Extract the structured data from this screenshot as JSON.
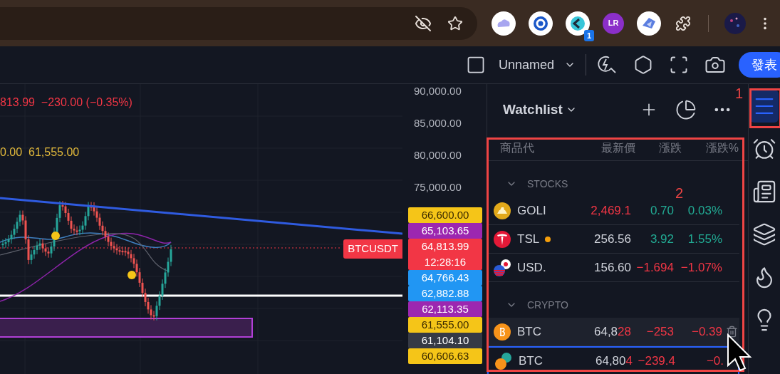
{
  "browser": {
    "extensions": [
      {
        "kind": "cloud"
      },
      {
        "kind": "target"
      },
      {
        "kind": "arrow",
        "badge": "1"
      },
      {
        "kind": "letters",
        "label": "LR"
      },
      {
        "kind": "bird"
      }
    ]
  },
  "toolbar": {
    "layout_name": "Unnamed",
    "publish_button": "發表"
  },
  "chart": {
    "legend": [
      {
        "text": "813.99  −230.00 (−0.35%)",
        "color": "#f23645"
      },
      {
        "text": "0.00  61,555.00",
        "color": "#e2b93b"
      }
    ],
    "symbol_tag": "BTCUSDT"
  },
  "price_axis": {
    "ticks": [
      "90,000.00",
      "85,000.00",
      "80,000.00",
      "75,000.00"
    ],
    "tags": [
      {
        "value": "66,600.00",
        "color": "#f5c518"
      },
      {
        "value": "65,103.65",
        "color": "#9c27b0"
      },
      {
        "value": "64,813.99",
        "time": "12:28:16",
        "color": "#f23645"
      },
      {
        "value": "64,766.43",
        "color": "#2196f3"
      },
      {
        "value": "62,882.88",
        "color": "#2196f3"
      },
      {
        "value": "62,113.35",
        "color": "#9c27b0"
      },
      {
        "value": "61,555.00",
        "color": "#f5c518"
      },
      {
        "value": "61,104.10",
        "color": "#363a45"
      },
      {
        "value": "60,606.63",
        "color": "#f5c518"
      }
    ]
  },
  "watchlist": {
    "title": "Watchlist",
    "columns": [
      "商品代",
      "最新價",
      "漲跌",
      "漲跌%"
    ],
    "groups": [
      {
        "name": "STOCKS",
        "expanded": true,
        "rows": [
          {
            "kind": "gold",
            "symbol": "GOLI",
            "status_dot": false,
            "last_parts": [
              {
                "text": "2,469.1",
                "flash": true
              }
            ],
            "change": "0.70",
            "change_pct": "0.03%",
            "rising": true,
            "hovered": false,
            "selected": false
          },
          {
            "kind": "t-badge",
            "symbol": "TSL",
            "status_dot": true,
            "last_parts": [
              {
                "text": "256.56",
                "flash": false
              }
            ],
            "change": "3.92",
            "change_pct": "1.55%",
            "rising": true,
            "hovered": false,
            "selected": false
          },
          {
            "kind": "flag-pair",
            "symbol": "USD.",
            "status_dot": false,
            "last_parts": [
              {
                "text": "156.60",
                "flash": false
              }
            ],
            "change": "−1.694",
            "change_pct": "−1.07%",
            "rising": false,
            "hovered": false,
            "selected": false
          }
        ]
      },
      {
        "name": "CRYPTO",
        "expanded": true,
        "rows": [
          {
            "kind": "bitcoin",
            "symbol": "BTC",
            "status_dot": false,
            "last_parts": [
              {
                "text": "64,8",
                "flash": false
              },
              {
                "text": "28",
                "flash": true
              }
            ],
            "change": "−253",
            "change_pct": "−0.39",
            "rising": false,
            "hovered": true,
            "selected": false
          },
          {
            "kind": "coin-pair",
            "symbol": "BTC",
            "status_dot": false,
            "last_parts": [
              {
                "text": "64,80",
                "flash": false
              },
              {
                "text": "4",
                "flash": true
              }
            ],
            "change": "−239.4",
            "change_pct": "−0.",
            "rising": false,
            "hovered": false,
            "selected": true
          }
        ]
      }
    ]
  },
  "sidebar": [
    {
      "kind": "list",
      "selected": true
    },
    {
      "kind": "alarm",
      "selected": false
    },
    {
      "kind": "news",
      "selected": false
    },
    {
      "kind": "layers",
      "selected": false
    },
    {
      "kind": "flame",
      "selected": false
    },
    {
      "kind": "bulb",
      "selected": false
    }
  ],
  "annotations": [
    {
      "label": "1"
    },
    {
      "label": "2"
    }
  ]
}
